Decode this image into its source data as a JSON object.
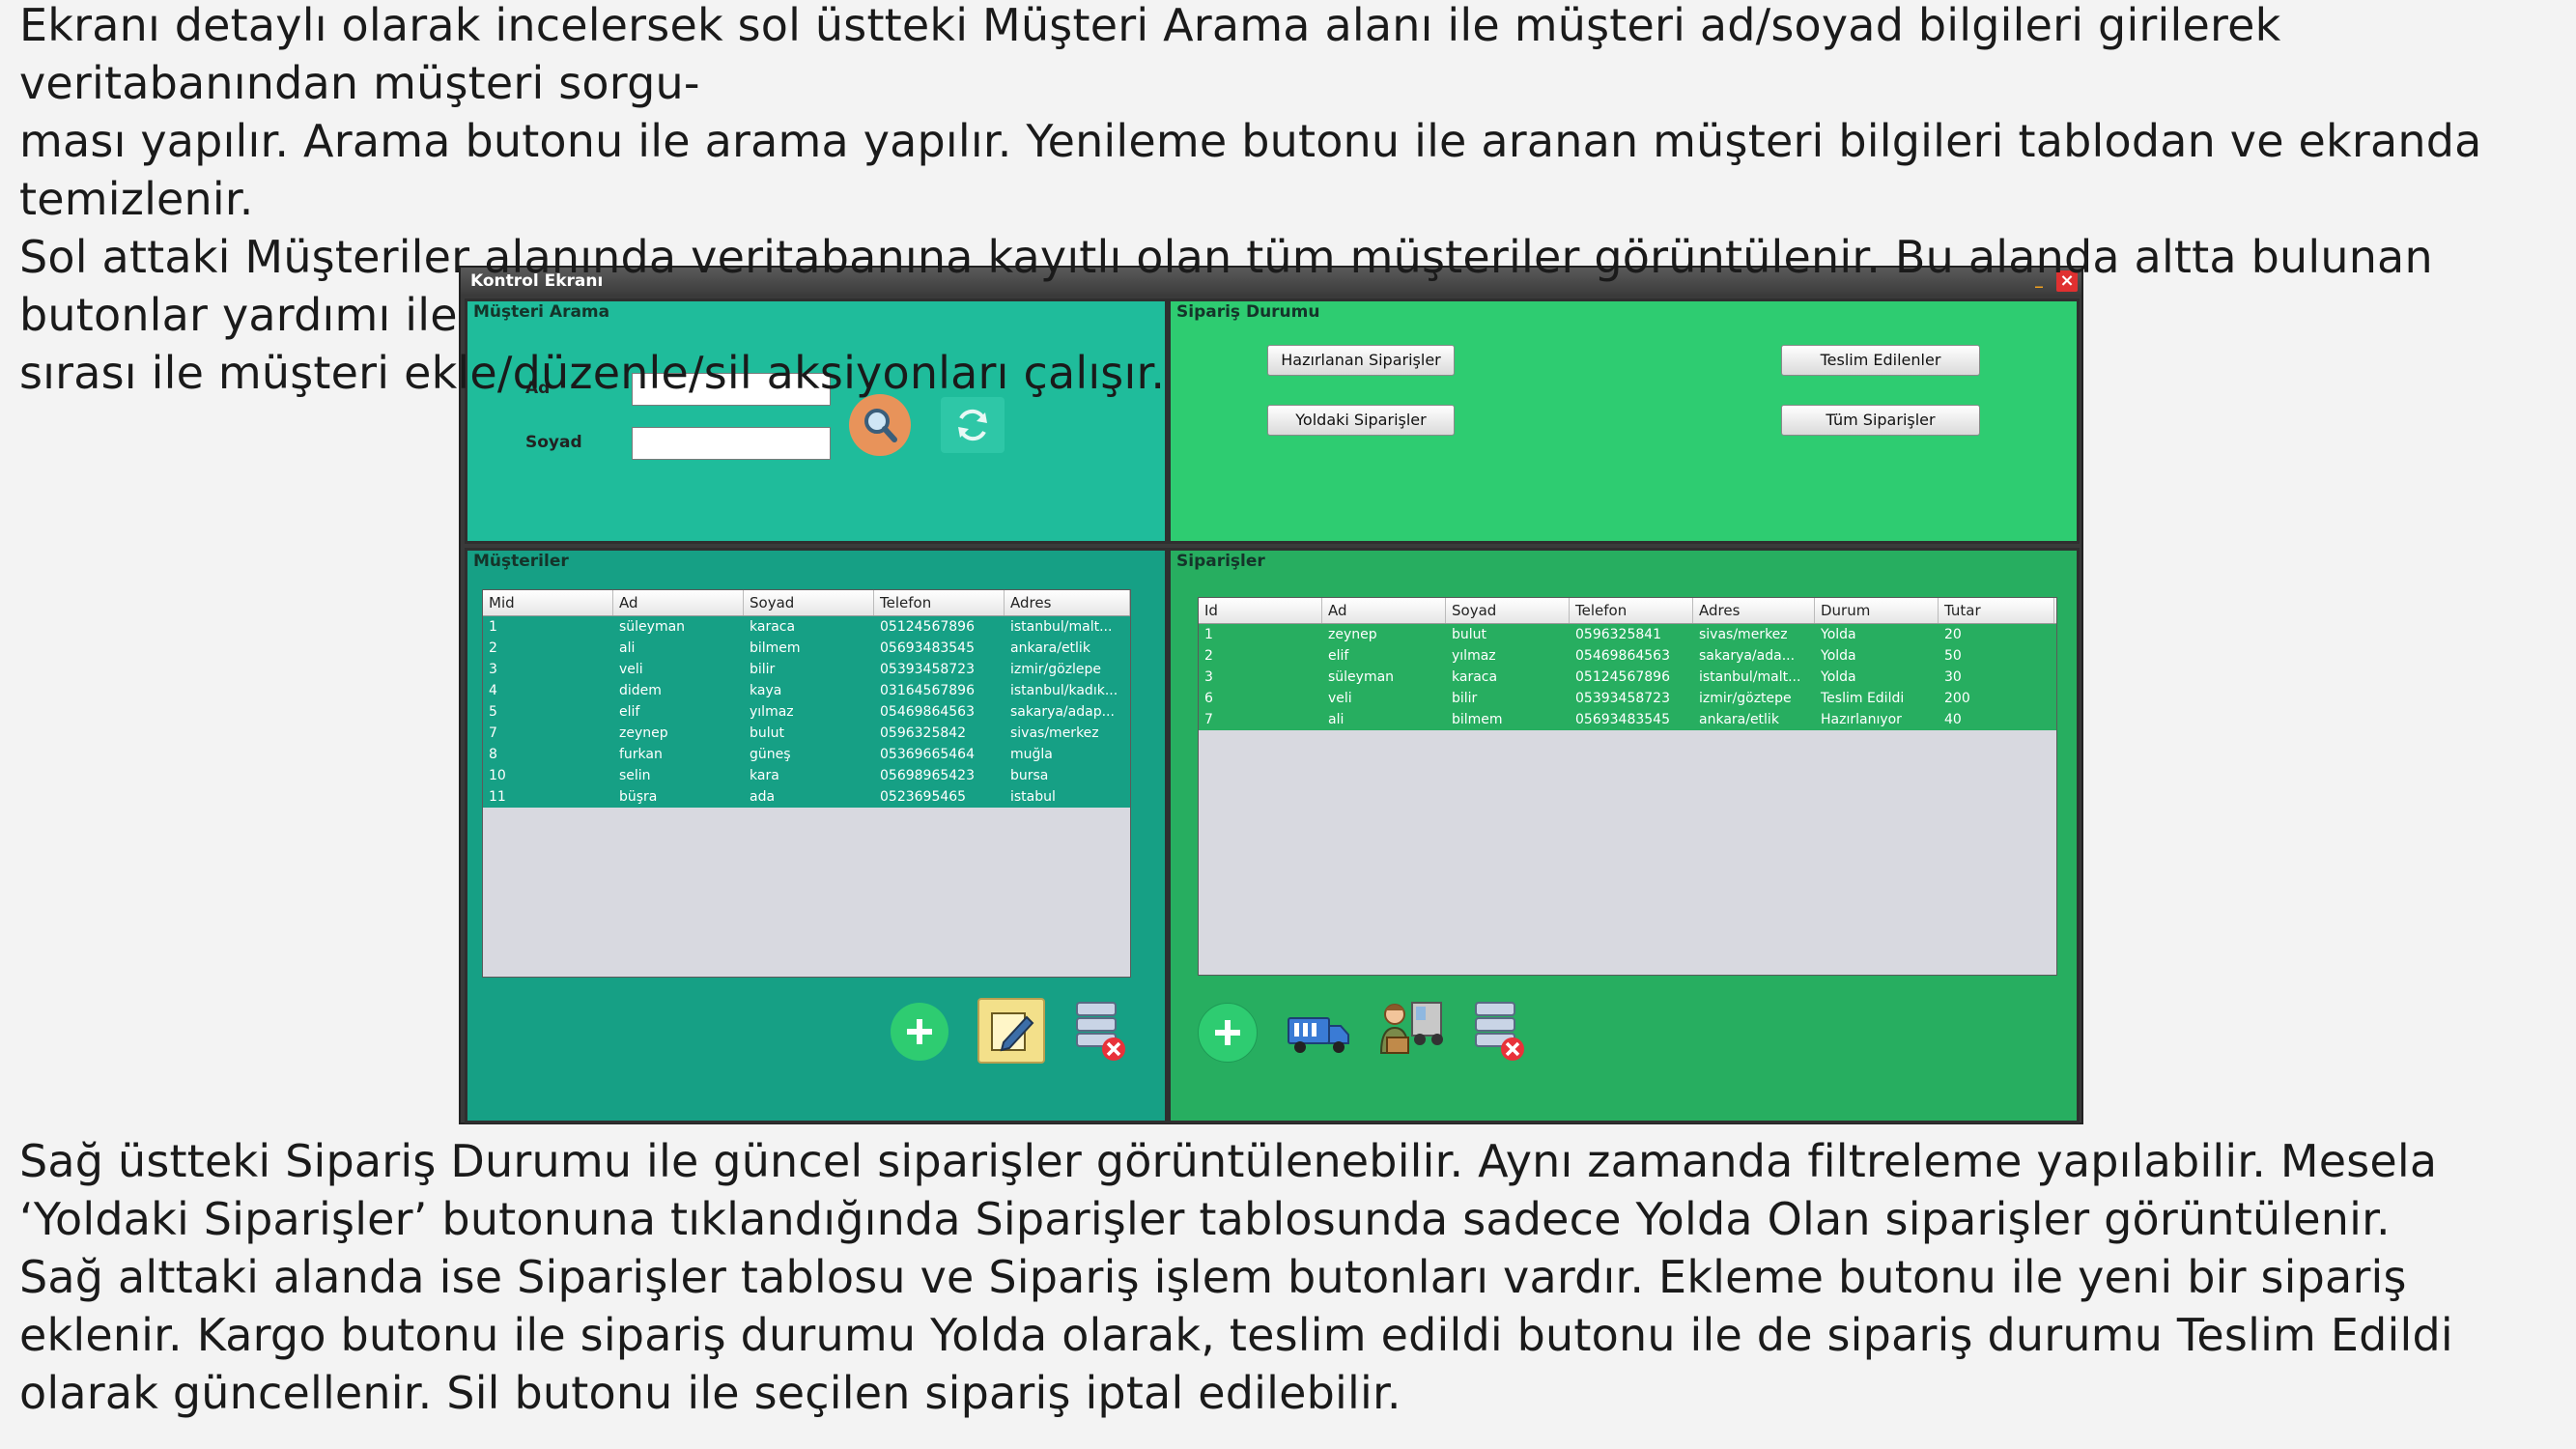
{
  "intro": {
    "lines": [
      "Ekranı detaylı olarak incelersek sol üstteki Müşteri Arama alanı ile müşteri ad/soyad bilgileri girilerek",
      "veritabanından müşteri sorgu-",
      "ması yapılır. Arama butonu ile arama yapılır. Yenileme butonu ile aranan müşteri bilgileri tablodan ve ekranda",
      "temizlenir.",
      "Sol attaki Müşteriler alanında veritabanına kayıtlı olan tüm müşteriler görüntülenir. Bu alanda altta bulunan",
      "butonlar yardımı ile",
      "sırası ile müşteri ekle/düzenle/sil aksiyonları çalışır."
    ]
  },
  "outro": {
    "lines": [
      "Sağ üstteki Sipariş Durumu ile güncel siparişler görüntülenebilir. Aynı zamanda filtreleme yapılabilir. Mesela",
      "‘Yoldaki Siparişler’ butonuna tıklandığında Siparişler tablosunda sadece Yolda Olan siparişler görüntülenir.",
      "Sağ alttaki alanda ise Siparişler tablosu ve Sipariş işlem butonları vardır. Ekleme butonu ile yeni bir sipariş",
      "eklenir. Kargo butonu ile sipariş durumu Yolda olarak, teslim edildi butonu ile de sipariş durumu Teslim Edildi",
      "olarak güncellenir. Sil butonu ile seçilen sipariş iptal edilebilir."
    ]
  },
  "window": {
    "title": "Kontrol Ekranı",
    "close_glyph": "×",
    "minimize_glyph": "_"
  },
  "search": {
    "title": "Müşteri Arama",
    "ad_label": "Ad",
    "soyad_label": "Soyad",
    "ad_value": "",
    "soyad_value": ""
  },
  "status": {
    "title": "Sipariş Durumu",
    "btn_preparing": "Hazırlanan Siparişler",
    "btn_delivered": "Teslim Edilenler",
    "btn_in_transit": "Yoldaki Siparişler",
    "btn_all": "Tüm Siparişler"
  },
  "customers": {
    "title": "Müşteriler",
    "columns": [
      "Mid",
      "Ad",
      "Soyad",
      "Telefon",
      "Adres"
    ],
    "rows": [
      [
        "1",
        "süleyman",
        "karaca",
        "05124567896",
        "istanbul/malt..."
      ],
      [
        "2",
        "ali",
        "bilmem",
        "05693483545",
        "ankara/etlik"
      ],
      [
        "3",
        "veli",
        "bilir",
        "05393458723",
        "izmir/gözlepe"
      ],
      [
        "4",
        "didem",
        "kaya",
        "03164567896",
        "istanbul/kadık..."
      ],
      [
        "5",
        "elif",
        "yılmaz",
        "05469864563",
        "sakarya/adap..."
      ],
      [
        "7",
        "zeynep",
        "bulut",
        "0596325842",
        "sivas/merkez"
      ],
      [
        "8",
        "furkan",
        "güneş",
        "05369665464",
        "muğla"
      ],
      [
        "10",
        "selin",
        "kara",
        "05698965423",
        "bursa"
      ],
      [
        "11",
        "büşra",
        "ada",
        "0523695465",
        "istabul"
      ]
    ]
  },
  "orders": {
    "title": "Siparişler",
    "columns": [
      "Id",
      "Ad",
      "Soyad",
      "Telefon",
      "Adres",
      "Durum",
      "Tutar"
    ],
    "rows": [
      [
        "1",
        "zeynep",
        "bulut",
        "0596325841",
        "sivas/merkez",
        "Yolda",
        "20"
      ],
      [
        "2",
        "elif",
        "yılmaz",
        "05469864563",
        "sakarya/ada...",
        "Yolda",
        "50"
      ],
      [
        "3",
        "süleyman",
        "karaca",
        "05124567896",
        "istanbul/malt...",
        "Yolda",
        "30"
      ],
      [
        "6",
        "veli",
        "bilir",
        "05393458723",
        "izmir/göztepe",
        "Teslim Edildi",
        "200"
      ],
      [
        "7",
        "ali",
        "bilmem",
        "05693483545",
        "ankara/etlik",
        "Hazırlanıyor",
        "40"
      ]
    ]
  },
  "colors": {
    "search_panel": "#1fbc9b",
    "status_panel": "#2ecc71",
    "customers_panel": "#16a085",
    "orders_panel": "#27ae60"
  }
}
